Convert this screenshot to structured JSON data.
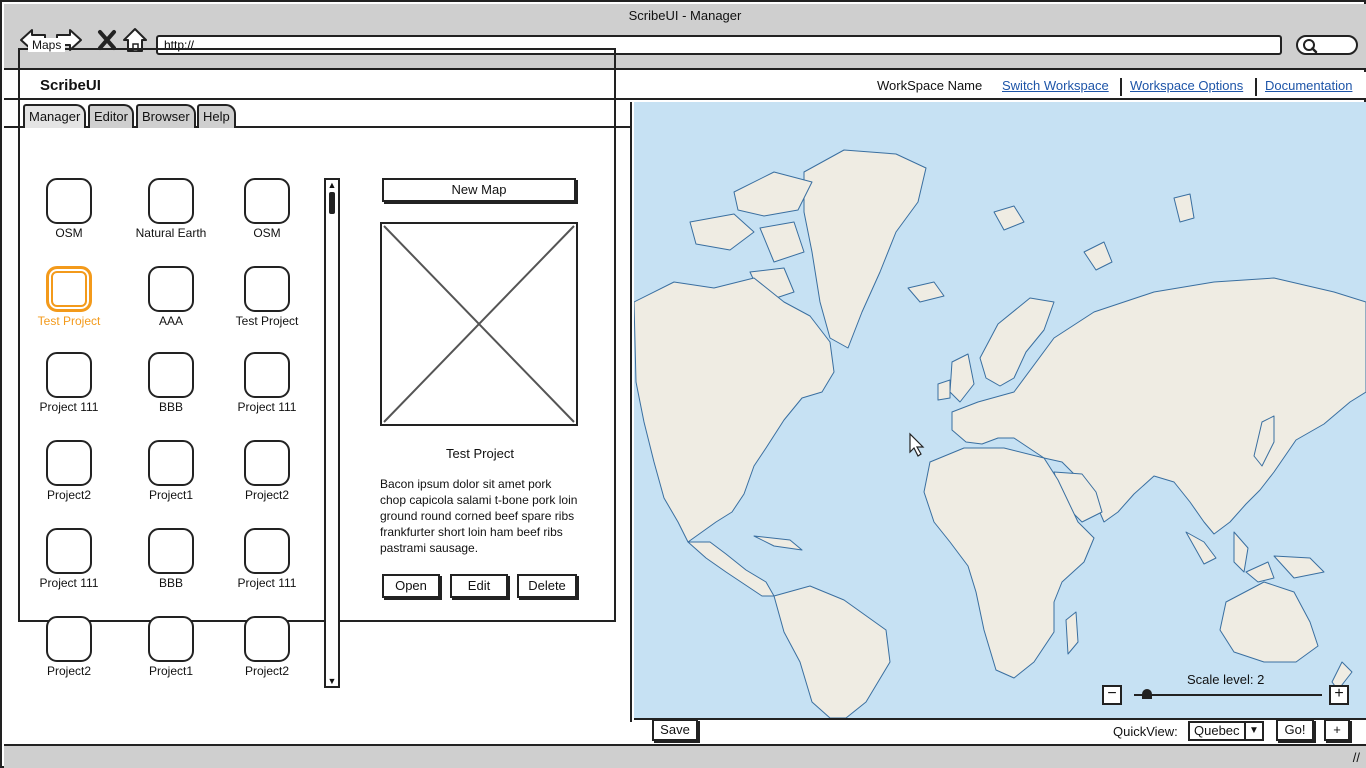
{
  "window": {
    "title": "ScribeUI - Manager"
  },
  "browser": {
    "url_value": "http://",
    "icons": [
      "back-arrow-icon",
      "forward-arrow-icon",
      "close-icon",
      "home-icon",
      "search-icon"
    ]
  },
  "header": {
    "brand": "ScribeUI",
    "workspace_name": "WorkSpace Name",
    "links": [
      "Switch Workspace",
      "Workspace Options",
      "Documentation"
    ]
  },
  "tabs": [
    {
      "label": "Manager",
      "active": true
    },
    {
      "label": "Editor",
      "active": false
    },
    {
      "label": "Browser",
      "active": false
    },
    {
      "label": "Help",
      "active": false
    }
  ],
  "maps_panel": {
    "legend": "Maps",
    "items": [
      {
        "label": "OSM",
        "selected": false
      },
      {
        "label": "Natural Earth",
        "selected": false
      },
      {
        "label": "OSM",
        "selected": false
      },
      {
        "label": "Test Project",
        "selected": true
      },
      {
        "label": "AAA",
        "selected": false
      },
      {
        "label": "Test Project",
        "selected": false
      },
      {
        "label": "Project 111",
        "selected": false
      },
      {
        "label": "BBB",
        "selected": false
      },
      {
        "label": "Project 111",
        "selected": false
      },
      {
        "label": "Project2",
        "selected": false
      },
      {
        "label": "Project1",
        "selected": false
      },
      {
        "label": "Project2",
        "selected": false
      },
      {
        "label": "Project 111",
        "selected": false
      },
      {
        "label": "BBB",
        "selected": false
      },
      {
        "label": "Project 111",
        "selected": false
      },
      {
        "label": "Project2",
        "selected": false
      },
      {
        "label": "Project1",
        "selected": false
      },
      {
        "label": "Project2",
        "selected": false
      }
    ],
    "new_map_button": "New Map",
    "preview_title": "Test Project",
    "description": "Bacon ipsum dolor sit amet pork chop capicola salami t-bone pork loin ground round corned beef spare ribs frankfurter short loin ham beef ribs pastrami sausage.",
    "actions": {
      "open": "Open",
      "edit": "Edit",
      "delete": "Delete"
    }
  },
  "map_view": {
    "scale_label": "Scale level: 2",
    "zoom_out": "−",
    "zoom_in": "+",
    "ocean_color": "#c6e1f3",
    "land_color": "#efece3",
    "coast_color": "#3a6fa0"
  },
  "bottom_bar": {
    "save_button": "Save",
    "quickview_label": "QuickView:",
    "quickview_value": "Quebec",
    "go_button": "Go!",
    "plus_button": "+"
  }
}
